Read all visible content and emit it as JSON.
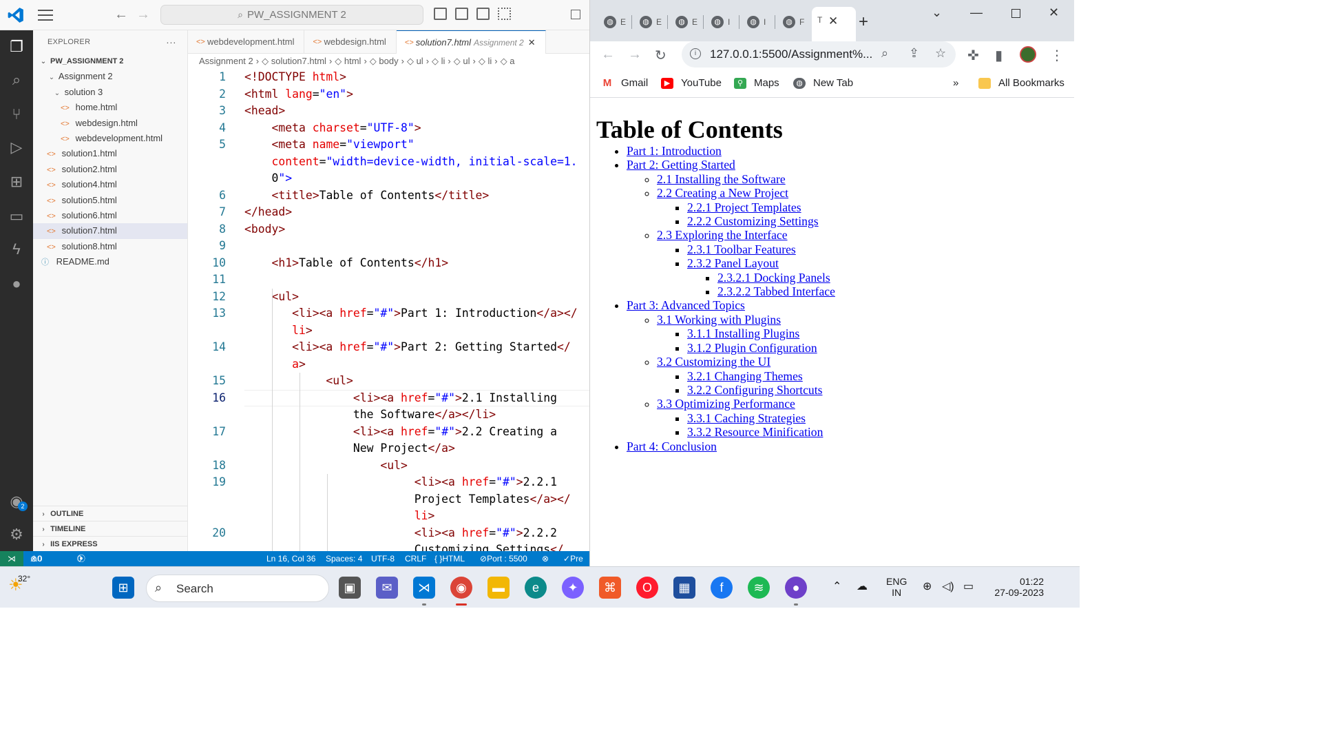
{
  "vscode": {
    "search_box": "PW_ASSIGNMENT 2",
    "explorer_title": "EXPLORER",
    "explorer_more": "···",
    "tree": [
      {
        "label": "PW_ASSIGNMENT 2",
        "kind": "root"
      },
      {
        "label": "Assignment 2",
        "kind": "folder"
      },
      {
        "label": "solution 3",
        "kind": "folder"
      },
      {
        "label": "home.html",
        "kind": "html"
      },
      {
        "label": "webdesign.html",
        "kind": "html"
      },
      {
        "label": "webdevelopment.html",
        "kind": "html"
      },
      {
        "label": "solution1.html",
        "kind": "html"
      },
      {
        "label": "solution2.html",
        "kind": "html"
      },
      {
        "label": "solution4.html",
        "kind": "html"
      },
      {
        "label": "solution5.html",
        "kind": "html"
      },
      {
        "label": "solution6.html",
        "kind": "html"
      },
      {
        "label": "solution7.html",
        "kind": "html",
        "selected": true
      },
      {
        "label": "solution8.html",
        "kind": "html"
      },
      {
        "label": "README.md",
        "kind": "info"
      }
    ],
    "panels": [
      "OUTLINE",
      "TIMELINE",
      "IIS EXPRESS"
    ],
    "account_badge": "2",
    "tabs": [
      {
        "label": "webdevelopment.html",
        "active": false
      },
      {
        "label": "webdesign.html",
        "active": false
      },
      {
        "label": "solution7.html",
        "desc": "Assignment 2",
        "active": true
      }
    ],
    "breadcrumb": [
      "Assignment 2",
      "solution7.html",
      "html",
      "body",
      "ul",
      "li",
      "ul",
      "li",
      "a"
    ],
    "current_line": "16",
    "code_lines": [
      {
        "n": "1",
        "t": "<!DOCTYPE html>"
      },
      {
        "n": "2",
        "t": "<html lang=\"en\">"
      },
      {
        "n": "3",
        "t": "<head>"
      },
      {
        "n": "4",
        "t": "    <meta charset=\"UTF-8\">"
      },
      {
        "n": "5",
        "t": "    <meta name=\"viewport\""
      },
      {
        "n": "",
        "t": "    content=\"width=device-width, initial-scale=1."
      },
      {
        "n": "",
        "t": "    0\">"
      },
      {
        "n": "6",
        "t": "    <title>Table of Contents</title>"
      },
      {
        "n": "7",
        "t": "</head>"
      },
      {
        "n": "8",
        "t": "<body>"
      },
      {
        "n": "9",
        "t": ""
      },
      {
        "n": "10",
        "t": "    <h1>Table of Contents</h1>"
      },
      {
        "n": "11",
        "t": ""
      },
      {
        "n": "12",
        "t": "    <ul>"
      },
      {
        "n": "13",
        "t": "       <li><a href=\"#\">Part 1: Introduction</a></"
      },
      {
        "n": "",
        "t": "       li>"
      },
      {
        "n": "14",
        "t": "       <li><a href=\"#\">Part 2: Getting Started</"
      },
      {
        "n": "",
        "t": "       a>"
      },
      {
        "n": "15",
        "t": "            <ul>"
      },
      {
        "n": "16",
        "t": "                <li><a href=\"#\">2.1 Installing"
      },
      {
        "n": "",
        "t": "                the Software</a></li>"
      },
      {
        "n": "17",
        "t": "                <li><a href=\"#\">2.2 Creating a"
      },
      {
        "n": "",
        "t": "                New Project</a>"
      },
      {
        "n": "18",
        "t": "                    <ul>"
      },
      {
        "n": "19",
        "t": "                         <li><a href=\"#\">2.2.1"
      },
      {
        "n": "",
        "t": "                         Project Templates</a></"
      },
      {
        "n": "",
        "t": "                         li>"
      },
      {
        "n": "20",
        "t": "                         <li><a href=\"#\">2.2.2"
      },
      {
        "n": "",
        "t": "                         Customizing Settings</"
      }
    ],
    "status": {
      "errors": "⊗0",
      "warnings": "⚠0",
      "ports": "0",
      "position": "Ln 16, Col 36",
      "spaces": "Spaces: 4",
      "encoding": "UTF-8",
      "eol": "CRLF",
      "language": "HTML",
      "port": "Port : 5500",
      "prettier": "Pre"
    }
  },
  "browser": {
    "mini_tabs": [
      "E",
      "E",
      "E",
      "I",
      "I",
      "F"
    ],
    "active_tab_title": "T",
    "url": "127.0.0.1:5500/Assignment%...",
    "bookmarks": [
      "Gmail",
      "YouTube",
      "Maps",
      "New Tab"
    ],
    "bookmarks_more": "»",
    "all_bookmarks": "All Bookmarks",
    "page": {
      "title": "Table of Contents",
      "toc": [
        {
          "label": "Part 1: Introduction"
        },
        {
          "label": "Part 2: Getting Started",
          "children": [
            {
              "label": "2.1 Installing the Software"
            },
            {
              "label": "2.2 Creating a New Project",
              "children": [
                {
                  "label": "2.2.1 Project Templates"
                },
                {
                  "label": "2.2.2 Customizing Settings"
                }
              ]
            },
            {
              "label": "2.3 Exploring the Interface",
              "children": [
                {
                  "label": "2.3.1 Toolbar Features"
                },
                {
                  "label": "2.3.2 Panel Layout",
                  "children": [
                    {
                      "label": "2.3.2.1 Docking Panels"
                    },
                    {
                      "label": "2.3.2.2 Tabbed Interface"
                    }
                  ]
                }
              ]
            }
          ]
        },
        {
          "label": "Part 3: Advanced Topics",
          "children": [
            {
              "label": "3.1 Working with Plugins",
              "children": [
                {
                  "label": "3.1.1 Installing Plugins"
                },
                {
                  "label": "3.1.2 Plugin Configuration"
                }
              ]
            },
            {
              "label": "3.2 Customizing the UI",
              "children": [
                {
                  "label": "3.2.1 Changing Themes"
                },
                {
                  "label": "3.2.2 Configuring Shortcuts"
                }
              ]
            },
            {
              "label": "3.3 Optimizing Performance",
              "children": [
                {
                  "label": "3.3.1 Caching Strategies"
                },
                {
                  "label": "3.3.2 Resource Minification"
                }
              ]
            }
          ]
        },
        {
          "label": "Part 4: Conclusion"
        }
      ]
    }
  },
  "taskbar": {
    "weather_temp": "32°",
    "search_label": "Search",
    "language_1": "ENG",
    "language_2": "IN",
    "time": "01:22",
    "date": "27-09-2023"
  },
  "colors": {
    "vscode_accent": "#007acc",
    "link": "#0000ee",
    "html_tag": "#800000",
    "html_attr": "#e50000",
    "html_value": "#0000ff"
  }
}
